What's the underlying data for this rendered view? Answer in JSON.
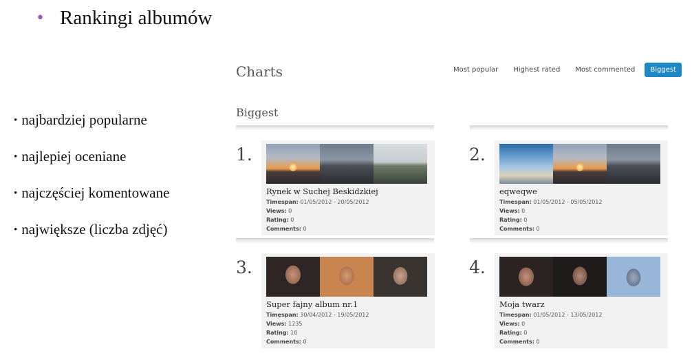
{
  "slide": {
    "title": "Rankingi albumów",
    "bullets": [
      "najbardziej popularne",
      "najlepiej oceniane",
      "najczęściej komentowane",
      "największe (liczba zdjęć)"
    ]
  },
  "page": {
    "title": "Charts",
    "tabs": [
      "Most popular",
      "Highest rated",
      "Most commented",
      "Biggest"
    ],
    "active_tab": "Biggest",
    "section_title": "Biggest",
    "accent_color": "#1e88c7"
  },
  "labels": {
    "timespan": "Timespan:",
    "views": "Views:",
    "rating": "Rating:",
    "comments": "Comments:"
  },
  "albums": [
    {
      "rank": "1.",
      "name": "Rynek w Suchej Beskidzkiej",
      "timespan": "01/05/2012 - 20/05/2012",
      "views": "0",
      "rating": "0",
      "comments": "0"
    },
    {
      "rank": "2.",
      "name": "eqweqwe",
      "timespan": "01/05/2012 - 05/05/2012",
      "views": "0",
      "rating": "0",
      "comments": "0"
    },
    {
      "rank": "3.",
      "name": "Super fajny album nr.1",
      "timespan": "30/04/2012 - 19/05/2012",
      "views": "1235",
      "rating": "10",
      "comments": "0"
    },
    {
      "rank": "4.",
      "name": "Moja twarz",
      "timespan": "01/05/2012 - 13/05/2012",
      "views": "0",
      "rating": "0",
      "comments": "0"
    }
  ]
}
